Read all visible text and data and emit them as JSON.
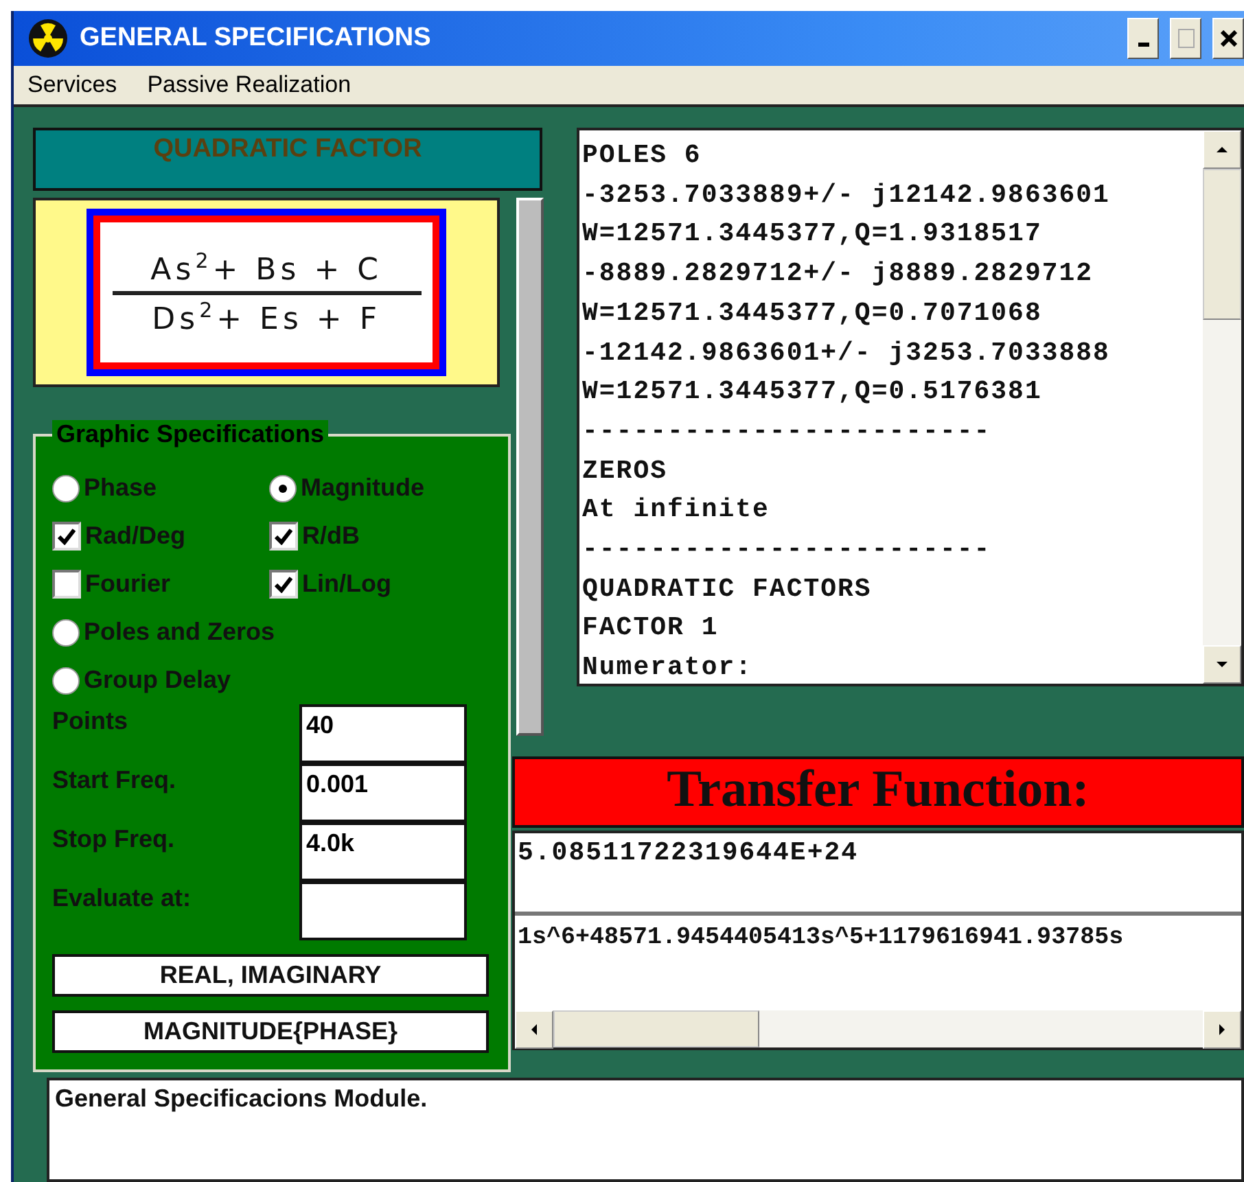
{
  "window": {
    "title": "GENERAL SPECIFICATIONS"
  },
  "menu": [
    "Services",
    "Passive Realization"
  ],
  "quadratic_factor": {
    "title": "QUADRATIC FACTOR",
    "numerator": "As$^{2}$+ Bs + C",
    "denominator": "Ds$^{2}$+ Es + F"
  },
  "graphic_specifications": {
    "title": "Graphic Specifications",
    "option_rows": [
      [
        {
          "kind": "radio",
          "label": "Phase",
          "selected": false
        },
        {
          "kind": "radio",
          "label": "Magnitude",
          "selected": true
        }
      ],
      [
        {
          "kind": "checkbox",
          "label": "Rad/Deg",
          "checked": true
        },
        {
          "kind": "checkbox",
          "label": "R/dB",
          "checked": true
        }
      ],
      [
        {
          "kind": "checkbox",
          "label": "Fourier",
          "checked": false
        },
        {
          "kind": "checkbox",
          "label": "Lin/Log",
          "checked": true
        }
      ],
      [
        {
          "kind": "radio",
          "label": "Poles and Zeros",
          "selected": false
        }
      ],
      [
        {
          "kind": "radio",
          "label": "Group Delay",
          "selected": false
        }
      ]
    ],
    "fields": [
      {
        "label": "Points",
        "value": "40"
      },
      {
        "label": "Start Freq.",
        "value": "0.001"
      },
      {
        "label": "Stop Freq.",
        "value": "4.0k"
      },
      {
        "label": "Evaluate at:"
      }
    ],
    "buttons": [
      "REAL, IMAGINARY",
      "MAGNITUDE{PHASE}"
    ]
  },
  "results": [
    "POLES 6",
    "-3253.7033889+/- j12142.9863601",
    "W=12571.3445377,Q=1.9318517",
    "-8889.2829712+/- j8889.2829712",
    "W=12571.3445377,Q=0.7071068",
    "-12142.9863601+/- j3253.7033888",
    "W=12571.3445377,Q=0.5176381",
    "------------------------",
    "ZEROS",
    "At infinite",
    "------------------------",
    "QUADRATIC FACTORS",
    "FACTOR 1",
    "Numerator:"
  ],
  "transfer_function": {
    "title": "Transfer Function:",
    "numerator": "5.08511722319644E+24",
    "denominator": "1s^6+48571.9454405413s^5+1179616941.93785s"
  },
  "status": "General Specificacions Module."
}
